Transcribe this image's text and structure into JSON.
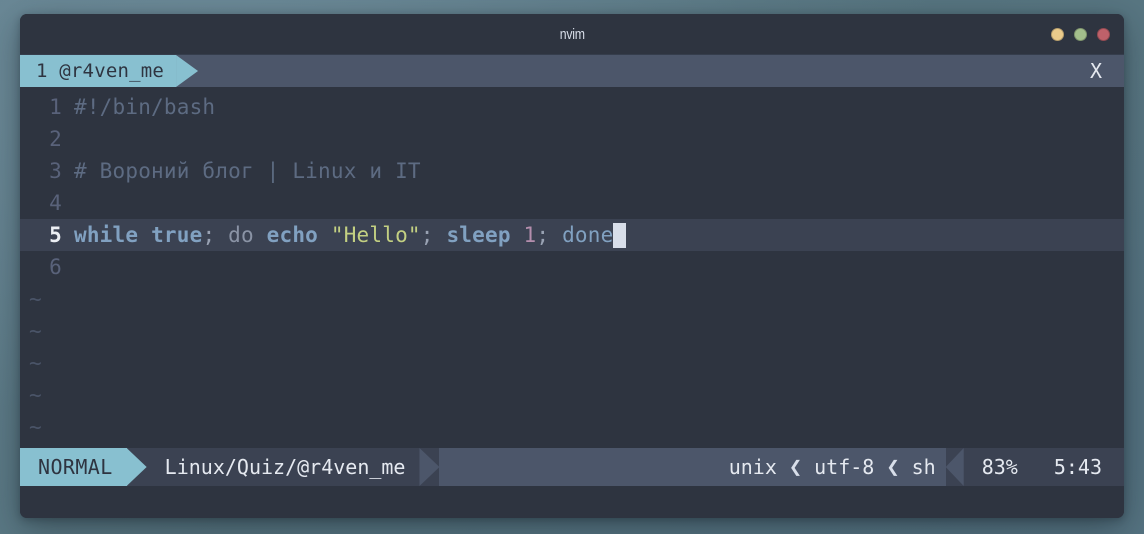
{
  "window": {
    "title": "nvim",
    "controls": [
      {
        "name": "minimize",
        "color": "#ebcb8b"
      },
      {
        "name": "maximize",
        "color": "#a3be8c"
      },
      {
        "name": "close",
        "color": "#bf616a"
      }
    ]
  },
  "tabline": {
    "active_tab": "1 @r4ven_me",
    "close_label": "X"
  },
  "editor": {
    "lines": [
      {
        "num": "1",
        "current": false,
        "tokens": [
          {
            "text": "#!/bin/bash",
            "cls": "s-comment"
          }
        ]
      },
      {
        "num": "2",
        "current": false,
        "tokens": []
      },
      {
        "num": "3",
        "current": false,
        "tokens": [
          {
            "text": "# Вороний блог | Linux и IT",
            "cls": "s-comment"
          }
        ]
      },
      {
        "num": "4",
        "current": false,
        "tokens": []
      },
      {
        "num": "5",
        "current": true,
        "tokens": [
          {
            "text": "while",
            "cls": "s-keyword"
          },
          {
            "text": " ",
            "cls": "s-plain"
          },
          {
            "text": "true",
            "cls": "s-keyword"
          },
          {
            "text": "; ",
            "cls": "s-punct"
          },
          {
            "text": "do",
            "cls": "s-plain"
          },
          {
            "text": " ",
            "cls": "s-plain"
          },
          {
            "text": "echo",
            "cls": "s-keyword"
          },
          {
            "text": " ",
            "cls": "s-plain"
          },
          {
            "text": "\"Hello\"",
            "cls": "s-string"
          },
          {
            "text": "; ",
            "cls": "s-punct"
          },
          {
            "text": "sleep",
            "cls": "s-keyword"
          },
          {
            "text": " ",
            "cls": "s-plain"
          },
          {
            "text": "1",
            "cls": "s-number"
          },
          {
            "text": "; ",
            "cls": "s-punct"
          },
          {
            "text": "done",
            "cls": "s-ident"
          }
        ]
      },
      {
        "num": "6",
        "current": false,
        "tokens": []
      }
    ],
    "empty_marker": "~",
    "empty_rows": 5
  },
  "statusline": {
    "mode": "NORMAL",
    "path": "Linux/Quiz/@r4ven_me",
    "fileformat": "unix",
    "encoding": "utf-8",
    "filetype": "sh",
    "percent": "83%",
    "position": "5:43",
    "thin_separator": "❮"
  },
  "colors": {
    "accent": "#88c0d0",
    "editor_bg": "#2e3440",
    "tabline_bg": "#4c566a",
    "current_line_bg": "#3b4252",
    "string": "#c3d082",
    "number": "#b48ead",
    "keyword": "#81a1c1",
    "comment": "#5d6b82"
  }
}
